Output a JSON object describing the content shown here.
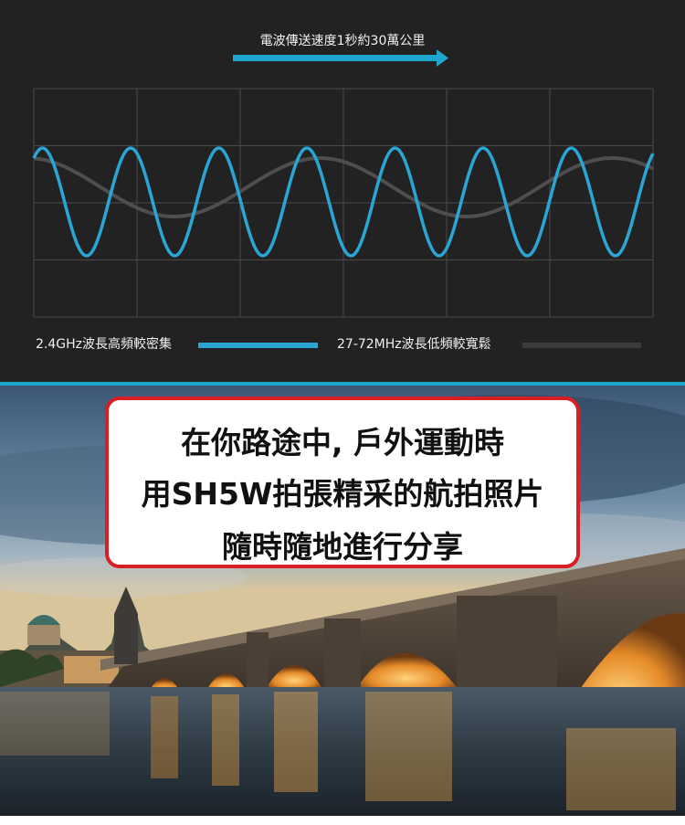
{
  "wave_panel": {
    "caption": "電波傳送速度1秒約30萬公里",
    "colors": {
      "background": "#222222",
      "grid": "#4a4a4a",
      "high_frequency_wave": "#2aa6d5",
      "low_frequency_wave": "#4e4e4e",
      "arrow": "#1fa6cf"
    },
    "legend": [
      {
        "label": "2.4GHz波長高頻較密集",
        "color": "#2aa6d5"
      },
      {
        "label": "27-72MHz波長低頻較寬鬆",
        "color": "#3c3c3c"
      }
    ]
  },
  "photo_panel": {
    "callout": {
      "lines": [
        "在你路途中, 戶外運動時",
        "用SH5W拍張精采的航拍照片",
        "隨時隨地進行分享"
      ],
      "border_color": "#d81f26"
    }
  }
}
